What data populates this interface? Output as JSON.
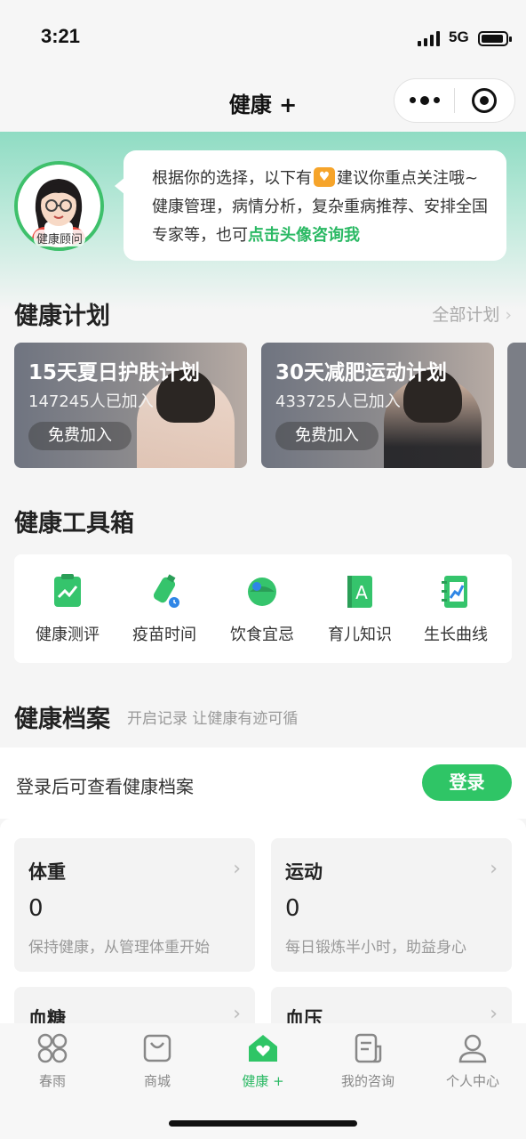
{
  "status": {
    "time": "3:21",
    "network": "5G"
  },
  "header": {
    "title": "健康 +"
  },
  "advisor": {
    "avatar_label": "健康顾问",
    "message_part1": "根据你的选择，以下有",
    "message_part2": "建议你重点关注哦~ 健康管理，病情分析，复杂重病推荐、安排全国专家等，也可",
    "message_link": "点击头像咨询我"
  },
  "plans": {
    "title": "健康计划",
    "more_label": "全部计划",
    "items": [
      {
        "title": "15天夏日护肤计划",
        "count": "147245人已加入",
        "button": "免费加入"
      },
      {
        "title": "30天减肥运动计划",
        "count": "433725人已加入",
        "button": "免费加入"
      }
    ]
  },
  "toolbox": {
    "title": "健康工具箱",
    "items": [
      {
        "label": "健康测评",
        "icon": "clipboard-chart-icon"
      },
      {
        "label": "疫苗时间",
        "icon": "vaccine-icon"
      },
      {
        "label": "饮食宜忌",
        "icon": "food-bowl-icon"
      },
      {
        "label": "育儿知识",
        "icon": "alphabet-book-icon"
      },
      {
        "label": "生长曲线",
        "icon": "growth-chart-icon"
      }
    ]
  },
  "records": {
    "title": "健康档案",
    "subtitle": "开启记录 让健康有迹可循",
    "login_prompt": "登录后可查看健康档案",
    "login_button": "登录",
    "cards": [
      {
        "title": "体重",
        "value": "0",
        "desc": "保持健康，从管理体重开始"
      },
      {
        "title": "运动",
        "value": "0",
        "desc": "每日锻炼半小时，助益身心"
      },
      {
        "title": "血糖"
      },
      {
        "title": "血压"
      }
    ]
  },
  "tabbar": {
    "items": [
      {
        "label": "春雨",
        "icon": "clover-icon",
        "active": false
      },
      {
        "label": "商城",
        "icon": "shopping-bag-icon",
        "active": false
      },
      {
        "label": "健康 +",
        "icon": "home-heart-icon",
        "active": true
      },
      {
        "label": "我的咨询",
        "icon": "document-icon",
        "active": false
      },
      {
        "label": "个人中心",
        "icon": "person-icon",
        "active": false
      }
    ]
  },
  "colors": {
    "accent": "#2fc566",
    "hero_top": "#8fdcc3",
    "badge": "#f6a42a"
  }
}
